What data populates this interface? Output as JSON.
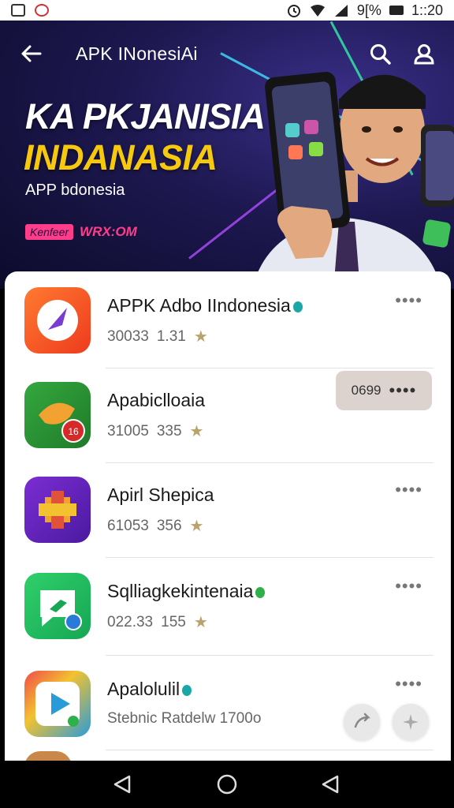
{
  "status_bar": {
    "battery_text": "9[%",
    "time": "1::20"
  },
  "header": {
    "title": "APK INonesiAi",
    "back_icon": "arrow-left-icon",
    "actions": [
      "search-icon",
      "profile-icon"
    ]
  },
  "banner": {
    "headline": "KA PKJANISIA",
    "subheadline": "INDANASIA",
    "tagline": "APP bdonesia",
    "promo_badge": "Kenfeer",
    "promo_code": "WRX:OM",
    "accent_yellow": "#f6c90e",
    "accent_pink": "#ff3d8b"
  },
  "apps": [
    {
      "name": "APPK Adbo IIndonesia",
      "downloads": "30033",
      "rating": "1.31",
      "verified": true,
      "icon": "compass-icon",
      "icon_colors": [
        "#ff6a2a",
        "#f0401f"
      ]
    },
    {
      "name": "Apabiclloaia",
      "downloads": "31005",
      "rating": "335",
      "verified": false,
      "icon": "bird-icon",
      "icon_colors": [
        "#2f9a3a",
        "#1f7a2a"
      ]
    },
    {
      "name": "Apirl Shepica",
      "downloads": "61053",
      "rating": "356",
      "verified": false,
      "icon": "emblem-icon",
      "icon_colors": [
        "#7a2bd0",
        "#4a1aa0"
      ]
    },
    {
      "name": "Sqlliagkekintenaia",
      "downloads": "022.33",
      "rating": "155",
      "verified": true,
      "icon": "chat-icon",
      "icon_colors": [
        "#2fd06a",
        "#16a654"
      ]
    },
    {
      "name": "Apalolulil",
      "meta_text": "Stebnic Ratdelw 1700o",
      "verified": true,
      "icon": "play-icon",
      "icon_colors": [
        "#f04a4a",
        "#2a9bd9"
      ]
    }
  ],
  "row_action_pill": {
    "label": "0699"
  },
  "fabs": [
    "share-icon",
    "sparkle-icon"
  ],
  "nav": [
    "back-triangle-icon",
    "home-circle-icon",
    "recents-triangle-icon"
  ]
}
